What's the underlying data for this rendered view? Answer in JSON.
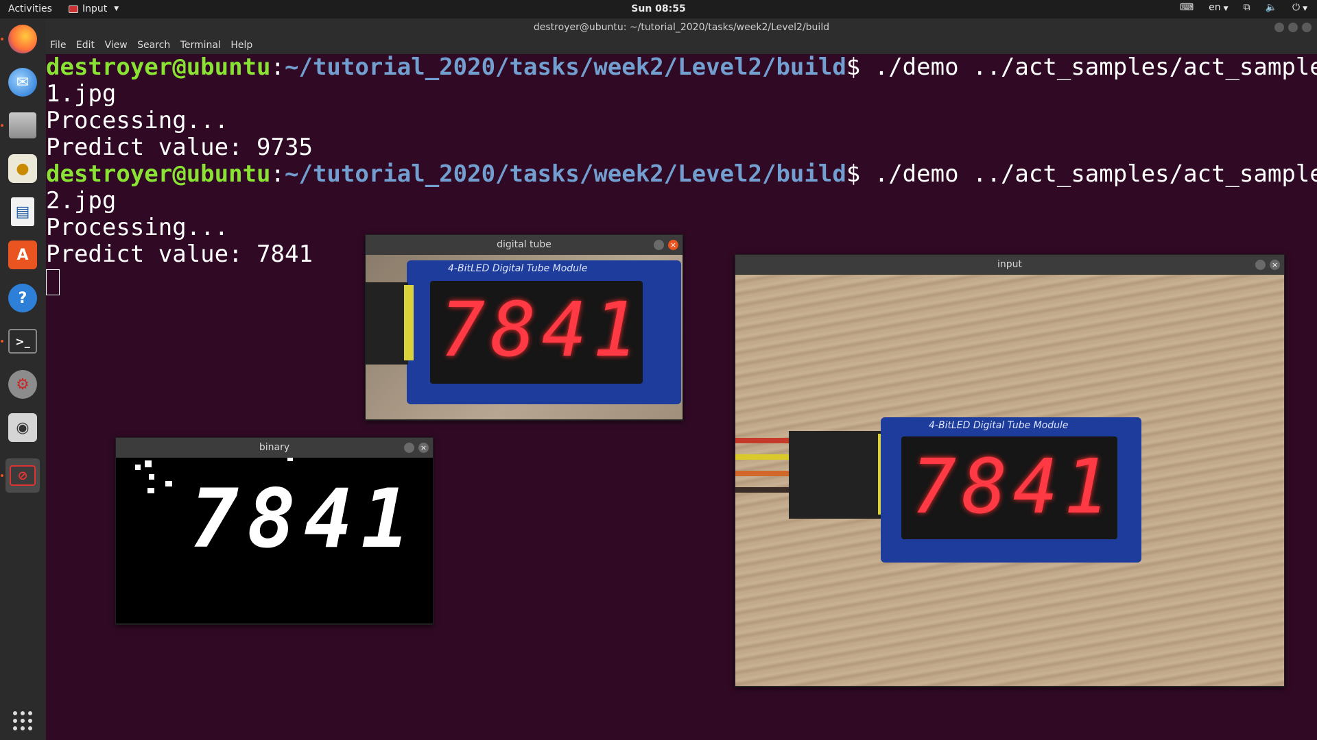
{
  "topbar": {
    "activities": "Activities",
    "input_menu": "Input",
    "clock": "Sun 08:55",
    "lang": "en"
  },
  "dock": {
    "items": [
      "firefox",
      "thunderbird",
      "files",
      "rhythmbox",
      "libreoffice-writer",
      "software",
      "help",
      "terminal",
      "settings",
      "screenshot",
      "image-viewer",
      "show-apps"
    ]
  },
  "terminal": {
    "title": "destroyer@ubuntu: ~/tutorial_2020/tasks/week2/Level2/build",
    "menu": [
      "File",
      "Edit",
      "View",
      "Search",
      "Terminal",
      "Help"
    ],
    "lines": [
      {
        "user": "destroyer@ubuntu",
        "path": "~/tutorial_2020/tasks/week2/Level2/build",
        "cmd": "$ ./demo ../act_samples/act_sample"
      },
      {
        "text": "1.jpg"
      },
      {
        "text": "Processing..."
      },
      {
        "text": "Predict value: 9735"
      },
      {
        "user": "destroyer@ubuntu",
        "path": "~/tutorial_2020/tasks/week2/Level2/build",
        "cmd": "$ ./demo ../act_samples/act_sample"
      },
      {
        "text": "2.jpg"
      },
      {
        "text": "Processing..."
      },
      {
        "text": "Predict value: 7841"
      }
    ]
  },
  "windows": {
    "digital_tube": {
      "title": "digital tube",
      "module_label": "4-BitLED Digital Tube Module",
      "digits": "7841"
    },
    "binary": {
      "title": "binary",
      "digits": "7841"
    },
    "input": {
      "title": "input",
      "module_label": "4-BitLED Digital Tube Module",
      "digits": "7841"
    }
  },
  "colors": {
    "terminal_bg": "#300a24",
    "prompt_user": "#8ae234",
    "prompt_path": "#729fcf",
    "accent": "#e95420"
  }
}
